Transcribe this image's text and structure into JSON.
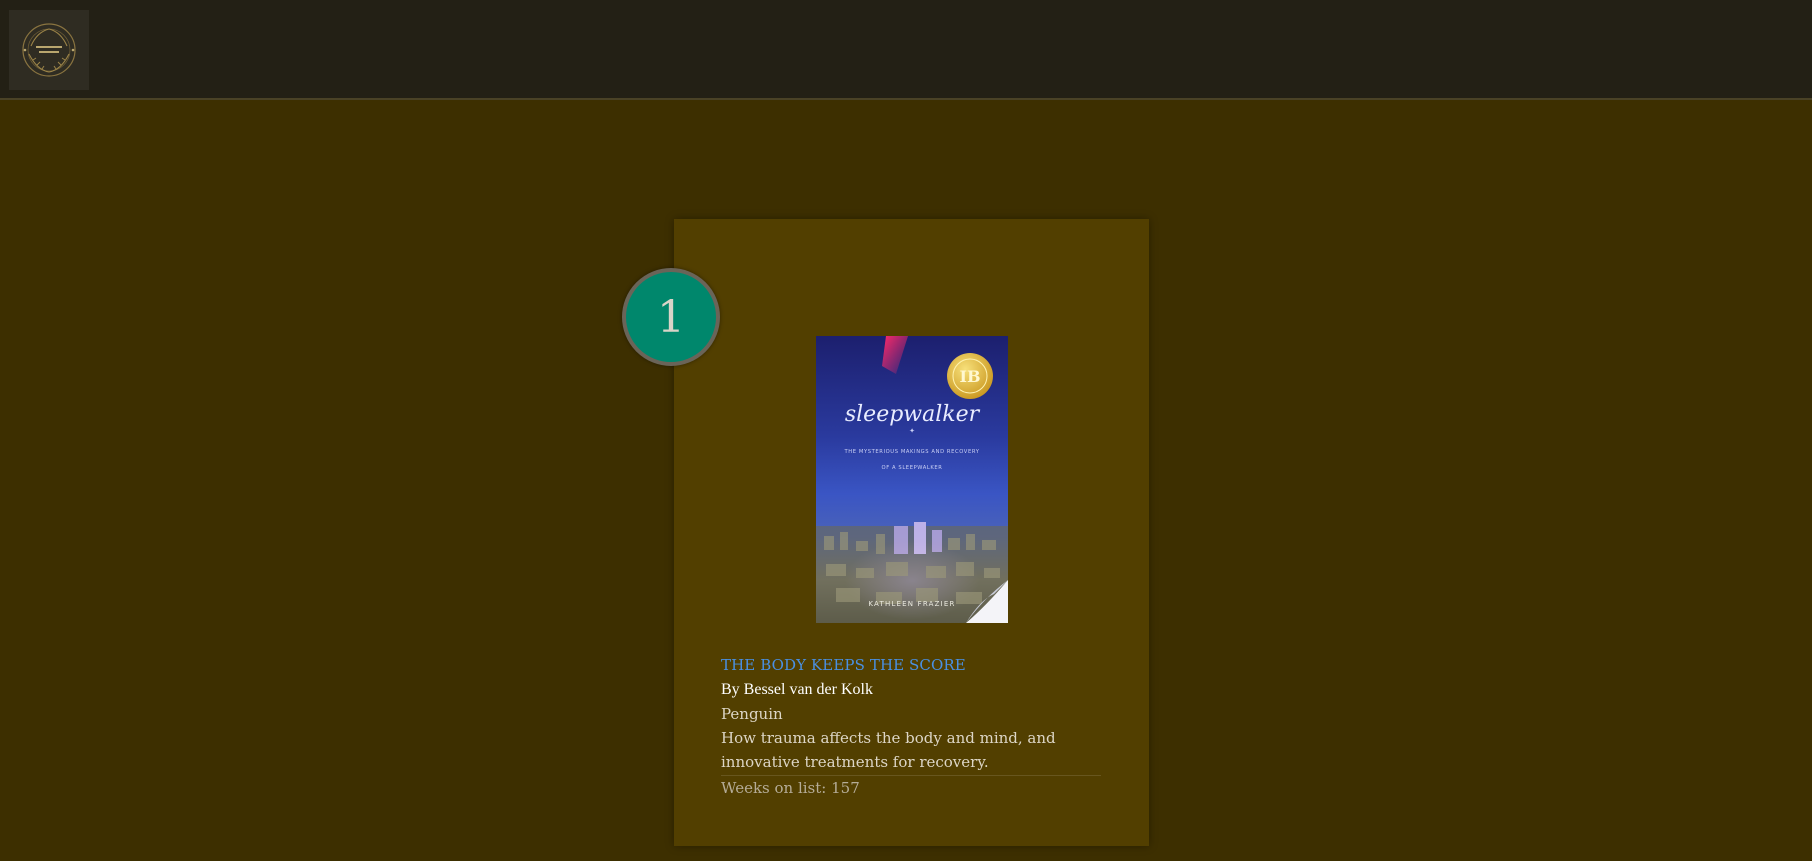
{
  "header": {
    "logo_icon": "circular-wreath-logo"
  },
  "book": {
    "rank": "1",
    "title": "THE BODY KEEPS THE SCORE",
    "author": "By Bessel van der Kolk",
    "publisher": "Penguin",
    "description": "How trauma affects the body and mind, and innovative treatments for recovery.",
    "weeks": "Weeks on list: 157",
    "cover": {
      "title": "sleepwalker",
      "subtitle_line1": "THE MYSTERIOUS MAKINGS AND RECOVERY",
      "subtitle_line2": "OF A SLEEPWALKER",
      "author": "KATHLEEN FRAZIER"
    }
  },
  "colors": {
    "page_bg": "#3d2f00",
    "header_bg": "#232015",
    "card_bg": "#523f00",
    "rank_badge": "#00876c",
    "title_link": "#4a90e2"
  }
}
